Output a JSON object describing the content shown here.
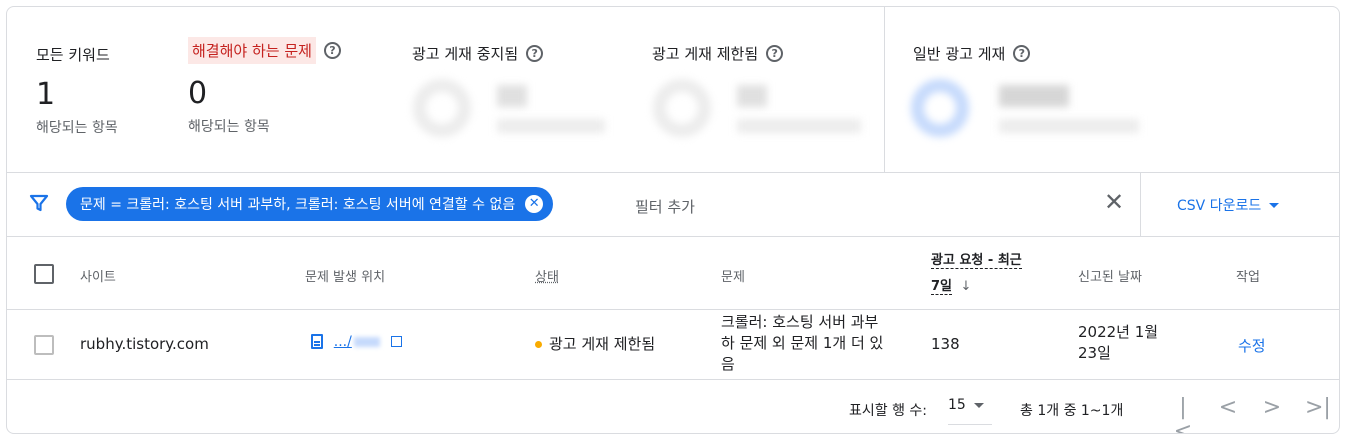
{
  "summary": {
    "all_keywords": {
      "label": "모든 키워드",
      "value": "1",
      "sub": "해당되는 항목"
    },
    "needs_fixing": {
      "label": "해결해야 하는 문제",
      "value": "0",
      "sub": "해당되는 항목"
    },
    "serving_stopped": {
      "label": "광고 게재 중지됨"
    },
    "serving_limited": {
      "label": "광고 게재 제한됨"
    },
    "serving_normal": {
      "label": "일반 광고 게재"
    },
    "help_icon": "?"
  },
  "filter": {
    "chip_text": "문제 = 크롤러: 호스팅 서버 과부하, 크롤러: 호스팅 서버에 연결할 수 없음",
    "add_filter": "필터 추가",
    "csv_download": "CSV 다운로드"
  },
  "table": {
    "headers": {
      "site": "사이트",
      "location": "문제 발생 위치",
      "status": "상태",
      "issue": "문제",
      "ad_requests_line1": "광고 요청 - 최근",
      "ad_requests_line2": "7일",
      "reported_date": "신고된 날짜",
      "action": "작업"
    },
    "rows": [
      {
        "site": "rubhy.tistory.com",
        "location_link": ".../",
        "status": "광고 게재 제한됨",
        "issue": "크롤러: 호스팅 서버 과부하 문제 외 문제 1개 더 있음",
        "ad_requests": "138",
        "reported_date": "2022년 1월 23일",
        "action": "수정"
      }
    ]
  },
  "footer": {
    "rows_per_page_label": "표시할 행 수:",
    "rows_per_page_value": "15",
    "range_text": "총 1개 중 1~1개"
  },
  "colors": {
    "accent": "#1a73e8",
    "highlight_bg": "#fce8e6",
    "highlight_text": "#c5221f",
    "status_limited": "#f9ab00"
  }
}
